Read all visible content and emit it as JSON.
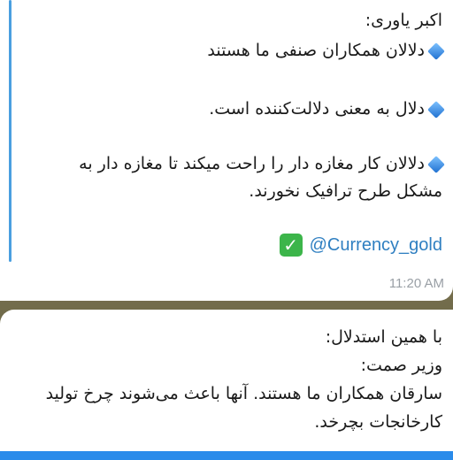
{
  "message1": {
    "author_line": "اکبر یاوری:",
    "items": [
      "دلالان همکاران صنفی ما هستند",
      "دلال به معنی دلالت‌کننده است.",
      "دلالان کار مغازه دار را راحت میکند تا مغازه دار به",
      "مشکل طرح ترافیک نخورند."
    ],
    "link": "@Currency_gold",
    "time": "11:20 AM"
  },
  "message2": {
    "lines": [
      "با همین استدلال:",
      "وزیر صمت:",
      "سارقان همکاران ما هستند. آنها باعث می‌شوند چرخ تولید",
      "کارخانجات بچرخد."
    ]
  },
  "colors": {
    "accent": "#4a9fe0",
    "link": "#2f7fc1",
    "check": "#3cb54a",
    "bottom_bar": "#2a8bea"
  }
}
